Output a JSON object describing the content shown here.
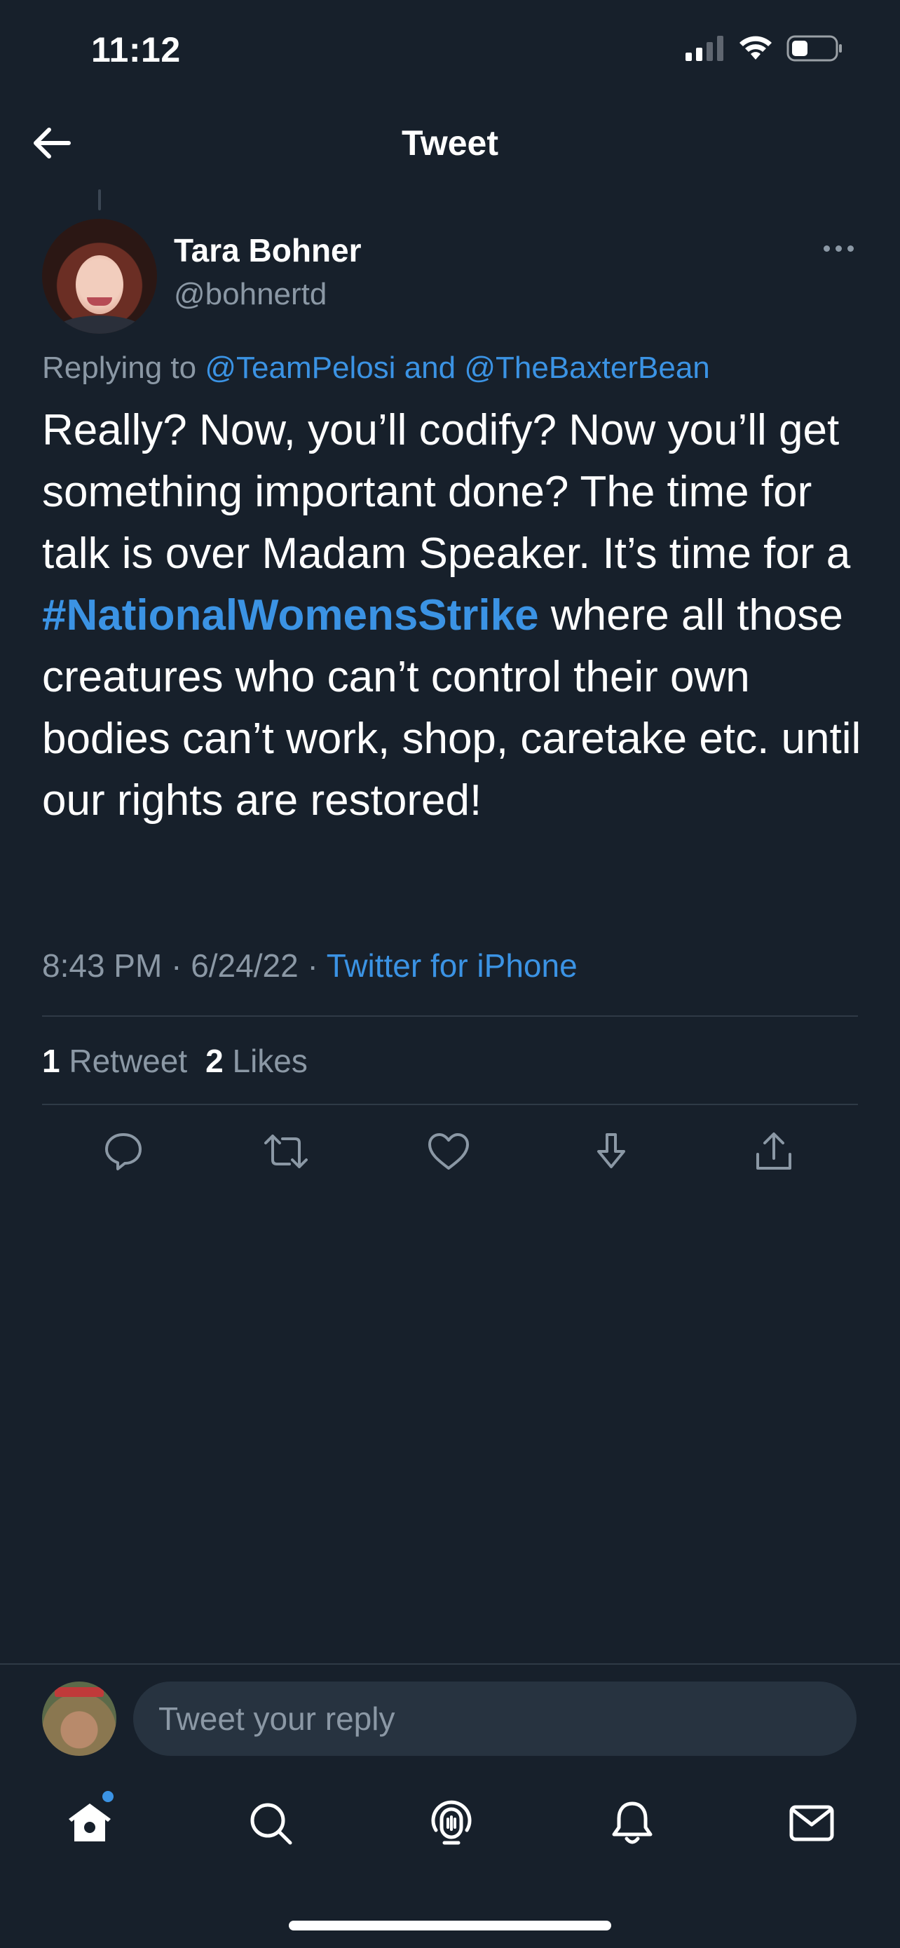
{
  "status_bar": {
    "time": "11:12",
    "icons": [
      "cellular-signal-icon",
      "wifi-icon",
      "battery-icon"
    ]
  },
  "header": {
    "title": "Tweet",
    "back_icon": "arrow-left-icon"
  },
  "tweet": {
    "author": {
      "display_name": "Tara Bohner",
      "handle": "@bohnertd"
    },
    "replying": {
      "prefix": "Replying to ",
      "first": "@TeamPelosi",
      "joiner": " and ",
      "second": "@TheBaxterBean"
    },
    "text_before": "Really? Now, you’ll codify? Now you’ll get something important done? The time for talk is over Madam Speaker. It’s time for a ",
    "hashtag": "#NationalWomensStrike",
    "text_after": " where all those creatures who can’t control their own bodies can’t work, shop, caretake etc. until our rights are restored!",
    "timestamp": "8:43 PM · 6/24/22 · ",
    "source": "Twitter for iPhone",
    "stats": {
      "retweets_count": "1",
      "retweets_label": " Retweet",
      "likes_count": "2",
      "likes_label": " Likes"
    },
    "actions": [
      "reply-icon",
      "retweet-icon",
      "like-icon",
      "bookmark-icon",
      "share-icon"
    ]
  },
  "reply_bar": {
    "placeholder": "Tweet your reply"
  },
  "tab_bar": {
    "tabs": [
      "home-icon",
      "search-icon",
      "spaces-icon",
      "notifications-icon",
      "messages-icon"
    ],
    "accent_color": "#3b93e4"
  },
  "colors": {
    "background": "#17202b",
    "link": "#3b93e4",
    "secondary_text": "#8b98a5"
  }
}
